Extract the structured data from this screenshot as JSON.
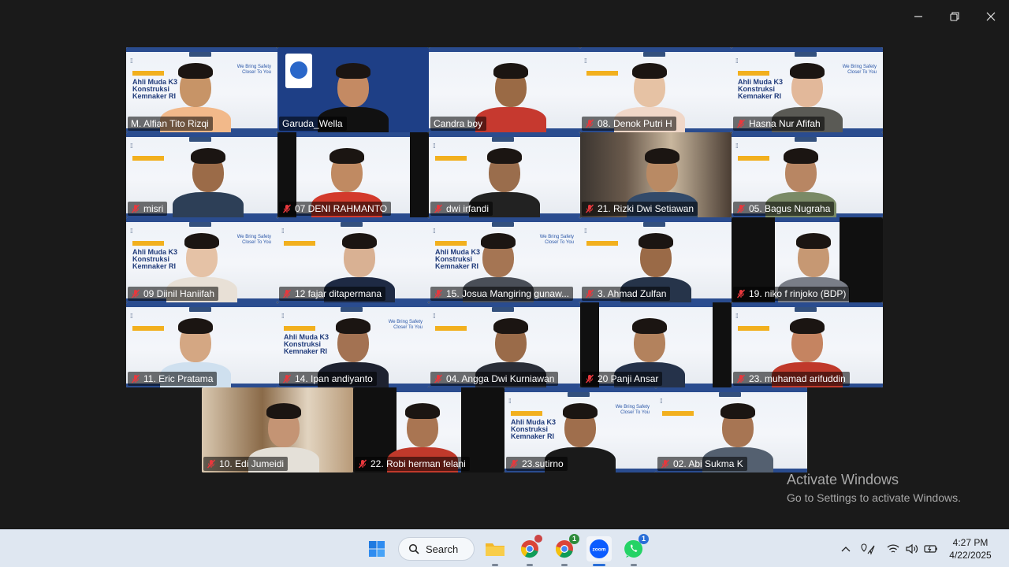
{
  "window": {
    "minimize": "minimize",
    "restore": "restore",
    "close": "close"
  },
  "participants": [
    {
      "name": "M. Alfian Tito Rizqi",
      "muted": false,
      "speaking": false
    },
    {
      "name": "Garuda_Wella",
      "muted": false,
      "speaking": true
    },
    {
      "name": "Candra boy",
      "muted": false,
      "speaking": false
    },
    {
      "name": "08. Denok Putri H",
      "muted": true,
      "speaking": false
    },
    {
      "name": "Hasna Nur Afifah",
      "muted": true,
      "speaking": false
    },
    {
      "name": "misri",
      "muted": true,
      "speaking": false
    },
    {
      "name": "07 DENI RAHMANTO",
      "muted": true,
      "speaking": false
    },
    {
      "name": "dwi irfandi",
      "muted": true,
      "speaking": false
    },
    {
      "name": "21. Rizki Dwi Setiawan",
      "muted": true,
      "speaking": false
    },
    {
      "name": "05. Bagus Nugraha",
      "muted": true,
      "speaking": false
    },
    {
      "name": "09 Diinil Haniifah",
      "muted": true,
      "speaking": false
    },
    {
      "name": "12 fajar ditapermana",
      "muted": true,
      "speaking": false
    },
    {
      "name": "15. Josua Mangiring gunaw...",
      "muted": true,
      "speaking": false
    },
    {
      "name": "3. Ahmad Zulfan",
      "muted": true,
      "speaking": false
    },
    {
      "name": "19. niko f rinjoko (BDP)",
      "muted": true,
      "speaking": false
    },
    {
      "name": "11. Eric Pratama",
      "muted": true,
      "speaking": false
    },
    {
      "name": "14. Ipan andiyanto",
      "muted": true,
      "speaking": false
    },
    {
      "name": "04. Angga Dwi Kurniawan",
      "muted": true,
      "speaking": false
    },
    {
      "name": "20 Panji Ansar",
      "muted": true,
      "speaking": false
    },
    {
      "name": "23. muhamad arifuddin",
      "muted": true,
      "speaking": false
    },
    {
      "name": "10. Edi Jumeidi",
      "muted": true,
      "speaking": false
    },
    {
      "name": "22. Robi herman felani",
      "muted": true,
      "speaking": false
    },
    {
      "name": "23.sutirno",
      "muted": true,
      "speaking": false
    },
    {
      "name": "02. Abi Sukma K",
      "muted": true,
      "speaking": false
    }
  ],
  "background_banner": {
    "headline": "Ahli Muda K3 Konstruksi Kemnaker RI",
    "slogan": "We Bring Safety Closer To You"
  },
  "activation": {
    "title": "Activate Windows",
    "subtitle": "Go to Settings to activate Windows."
  },
  "taskbar": {
    "search_label": "Search",
    "chrome1_badge": "",
    "chrome2_badge": "1",
    "whatsapp_badge": "1",
    "zoom_label": "zoom",
    "time": "4:27 PM",
    "date": "4/22/2025"
  }
}
